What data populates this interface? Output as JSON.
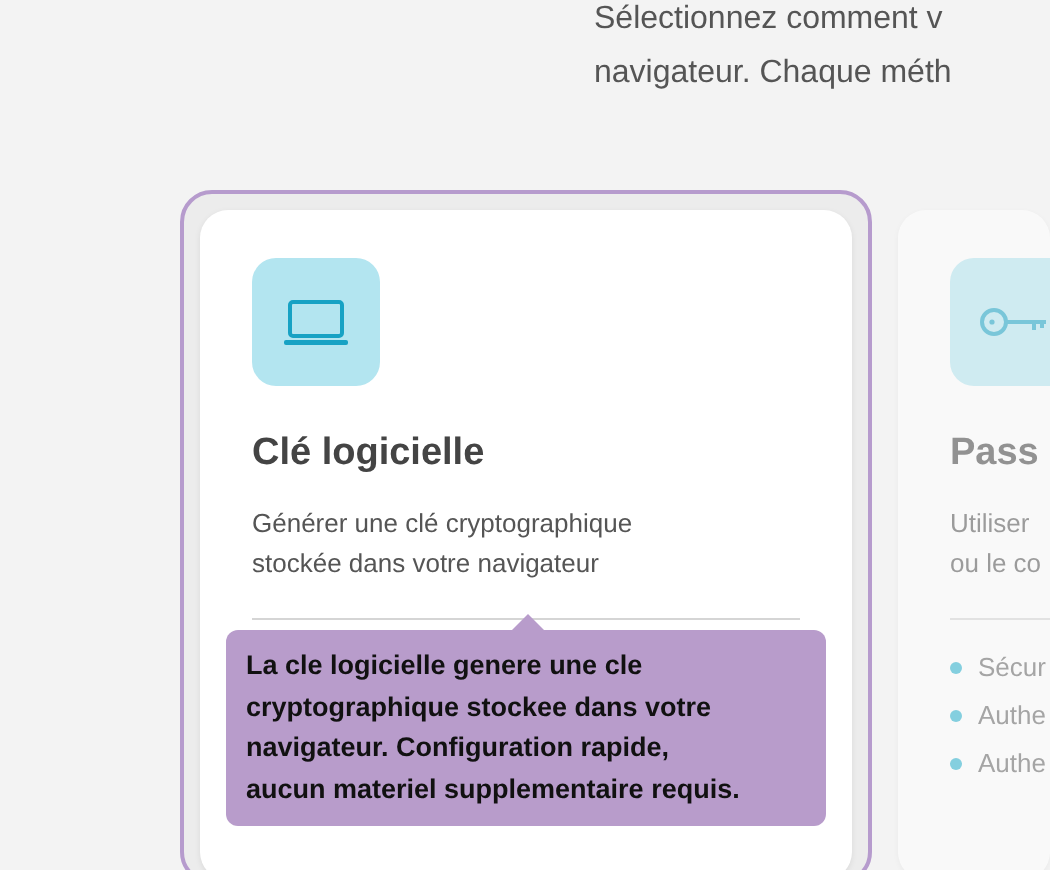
{
  "intro": {
    "lines": [
      "Sélectionnez comment v",
      "navigateur. Chaque méth"
    ]
  },
  "cards": [
    {
      "title": "Clé logicielle",
      "description": [
        "Générer une clé cryptographique",
        "stockée dans votre navigateur"
      ],
      "selected": true,
      "tooltip": "La cle logicielle genere une cle cryptographique stockee dans votre navigateur. Configuration rapide, aucun materiel supplementaire requis."
    },
    {
      "title": "Pass",
      "description": [
        "Utiliser",
        "ou le co"
      ],
      "selected": false,
      "features": [
        "Sécur",
        "Authe",
        "Authe"
      ]
    }
  ]
}
